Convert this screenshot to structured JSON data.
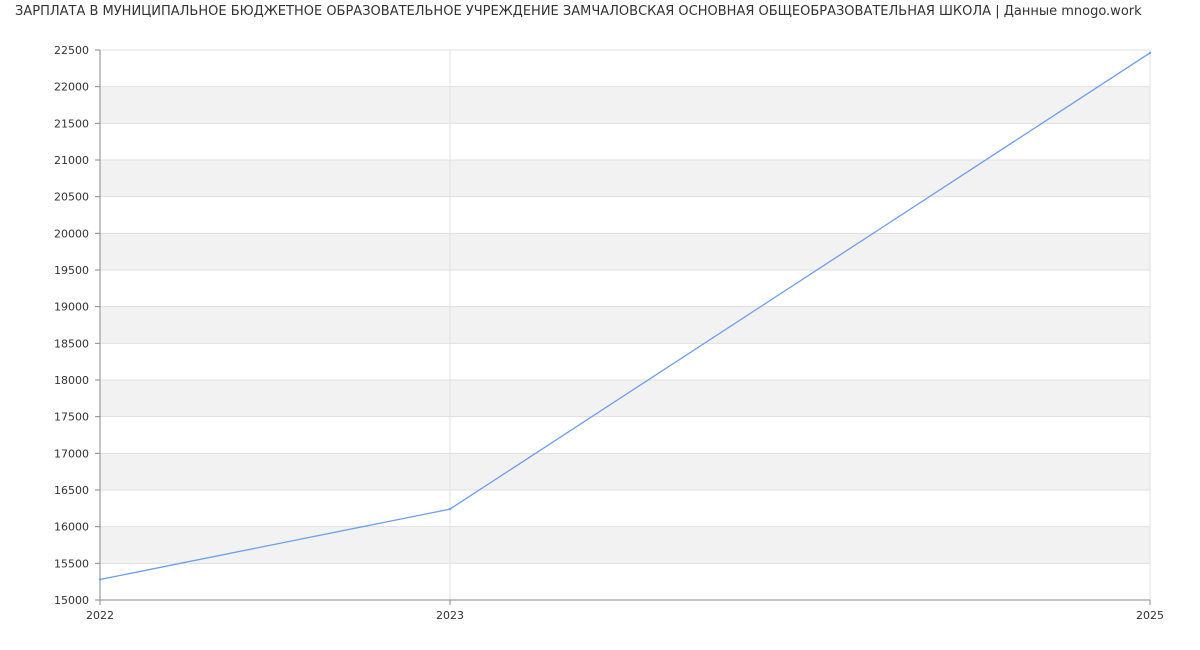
{
  "chart_data": {
    "type": "line",
    "title": "ЗАРПЛАТА В МУНИЦИПАЛЬНОЕ БЮДЖЕТНОЕ ОБРАЗОВАТЕЛЬНОЕ УЧРЕЖДЕНИЕ ЗАМЧАЛОВСКАЯ ОСНОВНАЯ ОБЩЕОБРАЗОВАТЕЛЬНАЯ ШКОЛА | Данные mnogo.work",
    "xlabel": "",
    "ylabel": "",
    "x": [
      2022,
      2023,
      2025
    ],
    "x_ticks": [
      "2022",
      "2023",
      "2025"
    ],
    "ylim": [
      15000,
      22500
    ],
    "y_ticks": [
      15000,
      15500,
      16000,
      16500,
      17000,
      17500,
      18000,
      18500,
      19000,
      19500,
      20000,
      20500,
      21000,
      21500,
      22000,
      22500
    ],
    "series": [
      {
        "values": [
          15280,
          16240,
          22460
        ]
      }
    ],
    "grid": true,
    "legend": "none",
    "colors": {
      "line": "#6d9eeb",
      "band": "#f2f2f2",
      "grid": "#e0e0e0",
      "axis": "#888888",
      "text": "#333333"
    }
  }
}
